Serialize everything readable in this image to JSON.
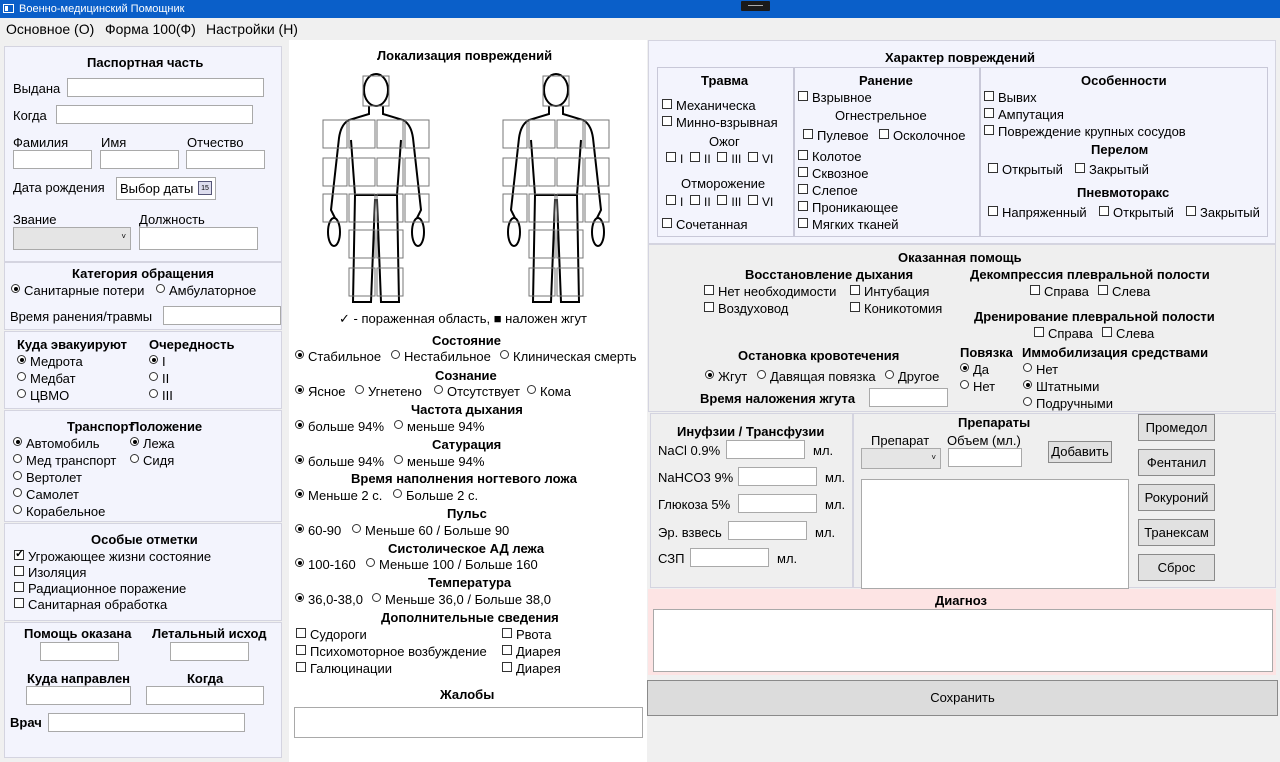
{
  "window": {
    "title": "Военно-медицинский Помощник"
  },
  "menu": [
    "Основное (О)",
    "Форма 100(Ф)",
    "Настройки (Н)"
  ],
  "passport": {
    "title": "Паспортная часть",
    "issued": "Выдана",
    "when": "Когда",
    "surname": "Фамилия",
    "name": "Имя",
    "patronymic": "Отчество",
    "birth": "Дата рождения",
    "date_button": "Выбор даты",
    "rank": "Звание",
    "position": "Должность"
  },
  "category": {
    "title": "Категория обращения",
    "opt1": "Санитарные потери",
    "opt2": "Амбулаторное",
    "time": "Время ранения/травмы"
  },
  "evac": {
    "title": "Куда эвакуируют",
    "items": [
      "Медрота",
      "Медбат",
      "ЦВМО"
    ],
    "queue_title": "Очередность",
    "queue": [
      "I",
      "II",
      "III"
    ]
  },
  "transport": {
    "title": "Транспорт",
    "items": [
      "Автомобиль",
      "Мед транспорт",
      "Вертолет",
      "Самолет",
      "Корабельное"
    ],
    "pos_title": "Положение",
    "pos": [
      "Лежа",
      "Сидя"
    ]
  },
  "notes": {
    "title": "Особые отметки",
    "items": [
      "Угрожающее жизни состояние",
      "Изоляция",
      "Радиационное поражение",
      "Санитарная обработка"
    ]
  },
  "bottom_left": {
    "help": "Помощь оказана",
    "lethal": "Летальный исход",
    "dest": "Куда направлен",
    "when": "Когда",
    "doctor": "Врач"
  },
  "localization": {
    "title": "Локализация повреждений",
    "legend": "✓ - пораженная область, ■ наложен жгут"
  },
  "state": {
    "title": "Состояние",
    "opts": [
      "Стабильное",
      "Нестабильное",
      "Клиническая смерть"
    ]
  },
  "consc": {
    "title": "Сознание",
    "opts": [
      "Ясное",
      "Угнетено",
      "Отсутствует",
      "Кома"
    ]
  },
  "resp": {
    "title": "Частота дыхания",
    "opts": [
      "больше 94%",
      "меньше 94%"
    ]
  },
  "sat": {
    "title": "Сатурация",
    "opts": [
      "больше 94%",
      "меньше 94%"
    ]
  },
  "nail": {
    "title": "Время наполнения ногтевого ложа",
    "opts": [
      "Меньше 2 с.",
      "Больше 2 с."
    ]
  },
  "pulse": {
    "title": "Пульс",
    "opts": [
      "60-90",
      "Меньше 60 / Больше 90"
    ]
  },
  "bp": {
    "title": "Систолическое АД лежа",
    "opts": [
      "100-160",
      "Меньше 100 / Больше 160"
    ]
  },
  "temp": {
    "title": "Температура",
    "opts": [
      "36,0-38,0",
      "Меньше 36,0 / Больше 38,0"
    ]
  },
  "extra": {
    "title": "Дополнительные сведения",
    "left": [
      "Судороги",
      "Психомоторное возбуждение",
      "Галюцинации"
    ],
    "right": [
      "Рвота",
      "Диарея",
      "Диарея"
    ]
  },
  "complaints": {
    "title": "Жалобы"
  },
  "injury": {
    "title": "Характер повреждений",
    "trauma": {
      "title": "Травма",
      "mech": "Механическа",
      "mine": "Минно-взрывная",
      "burn": "Ожог",
      "frost": "Отморожение",
      "deg": [
        "I",
        "II",
        "III",
        "VI"
      ],
      "combined": "Сочетанная"
    },
    "wound": {
      "title": "Ранение",
      "blast": "Взрывное",
      "gun": "Огнестрельное",
      "bullet": "Пулевое",
      "frag": "Осколочное",
      "items": [
        "Колотое",
        "Сквозное",
        "Слепое",
        "Проникающее",
        "Мягких тканей"
      ]
    },
    "feat": {
      "title": "Особенности",
      "items": [
        "Вывих",
        "Ампутация",
        "Повреждение крупных сосудов"
      ],
      "fracture": "Перелом",
      "open": "Открытый",
      "closed": "Закрытый",
      "pneumo": "Пневмоторакс",
      "tense": "Напряженный",
      "popen": "Открытый",
      "pclosed": "Закрытый"
    }
  },
  "aid": {
    "title": "Оказанная помощь",
    "breath": "Восстановление дыхания",
    "b_items": [
      "Нет необходимости",
      "Интубация",
      "Воздуховод",
      "Коникотомия"
    ],
    "decomp": "Декомпрессия плевральной полости",
    "right": "Справа",
    "left": "Слева",
    "drain": "Дренирование плевральной полости",
    "bleed": "Остановка кровотечения",
    "bleed_opts": [
      "Жгут",
      "Давящая повязка",
      "Другое"
    ],
    "tq_time": "Время наложения жгута",
    "bandage": "Повязка",
    "band_opts": [
      "Да",
      "Нет"
    ],
    "immob": "Иммобилизация средствами",
    "imm_opts": [
      "Нет",
      "Штатными",
      "Подручными"
    ]
  },
  "infusion": {
    "title": "Инуфзии / Трансфузии",
    "rows": [
      "NaCl 0.9%",
      "NaHCO3 9%",
      "Глюкоза 5%",
      "Эр. взвесь",
      "СЗП"
    ],
    "unit": "мл."
  },
  "drugs": {
    "title": "Препараты",
    "drug": "Препарат",
    "volume": "Объем (мл.)",
    "add": "Добавить",
    "buttons": [
      "Промедол",
      "Фентанил",
      "Рокуроний",
      "Транексам",
      "Сброс"
    ]
  },
  "diagnosis": {
    "title": "Диагноз"
  },
  "save": "Сохранить",
  "colors": {
    "titlebar": "#0a5fc9",
    "lavender": "#f3f4fd",
    "pink": "#fde4e4"
  }
}
